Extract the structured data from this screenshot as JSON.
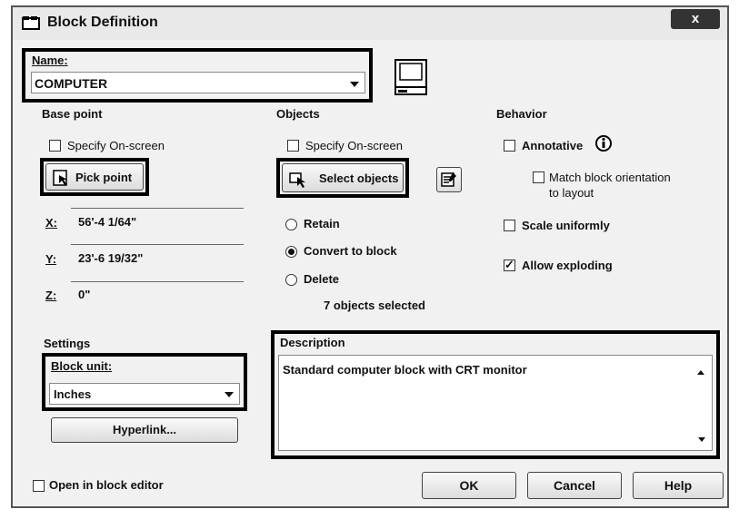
{
  "window": {
    "title": "Block Definition",
    "close_label": "x"
  },
  "name": {
    "label": "Name:",
    "value": "COMPUTER"
  },
  "base_point": {
    "heading": "Base point",
    "specify_on_screen": "Specify On-screen",
    "pick_point": "Pick point",
    "x_label": "X:",
    "x_value": "56'-4 1/64\"",
    "y_label": "Y:",
    "y_value": "23'-6 19/32\"",
    "z_label": "Z:",
    "z_value": "0\""
  },
  "objects": {
    "heading": "Objects",
    "specify_on_screen": "Specify On-screen",
    "select_objects": "Select objects",
    "retain": "Retain",
    "convert_to_block": "Convert to block",
    "delete": "Delete",
    "selected_count": "7 objects selected",
    "selected_option": "Convert to block"
  },
  "behavior": {
    "heading": "Behavior",
    "annotative": "Annotative",
    "match_orientation": "Match block orientation",
    "match_orientation_2": "to layout",
    "scale_uniformly": "Scale uniformly",
    "allow_exploding": "Allow exploding",
    "allow_exploding_checked": true
  },
  "settings": {
    "heading": "Settings",
    "block_unit_label": "Block unit:",
    "block_unit_value": "Inches",
    "hyperlink": "Hyperlink..."
  },
  "description": {
    "heading": "Description",
    "value": "Standard computer block with CRT monitor"
  },
  "footer": {
    "open_in_editor": "Open in block editor",
    "ok": "OK",
    "cancel": "Cancel",
    "help": "Help"
  }
}
